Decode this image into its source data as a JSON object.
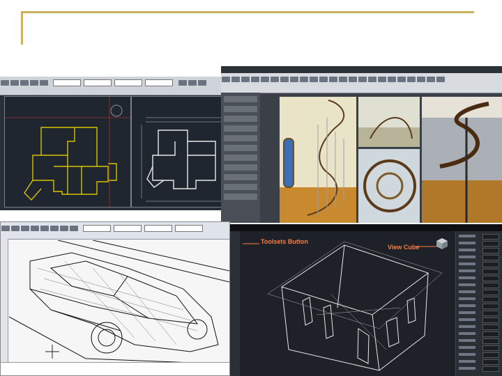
{
  "slide": {
    "accent_color": "#c9b25a"
  },
  "panels": {
    "plans": {
      "description_icon": "cad-floorplan"
    },
    "renders": {
      "description_icon": "stair-render"
    },
    "car": {
      "description_icon": "car-wireframe"
    },
    "house": {
      "callouts": {
        "toolsets": "Toolsets Button",
        "viewcube": "View Cube"
      },
      "callout_color": "#ff7a3c"
    }
  }
}
